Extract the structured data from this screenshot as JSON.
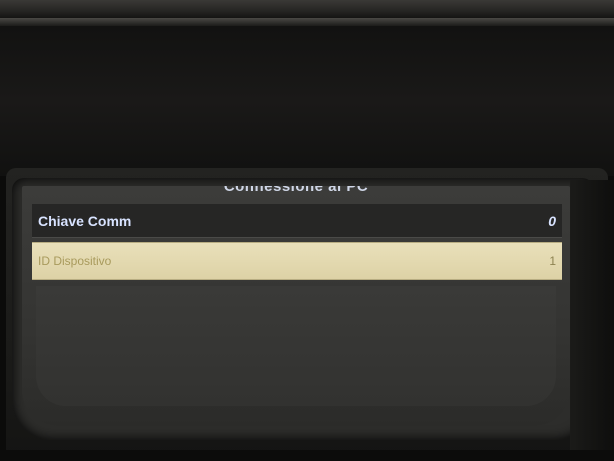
{
  "screen": {
    "title": "Connessione al PC",
    "menu": [
      {
        "label": "Chiave Comm",
        "value": "0",
        "selected": false
      },
      {
        "label": "ID Dispositivo",
        "value": "1",
        "selected": true
      }
    ]
  },
  "colors": {
    "device_body": "#121211",
    "screen_background": "#363634",
    "row_normal_text": "#d8e3ff",
    "row_selected_background": "#e5dbb3",
    "row_selected_text": "#a89a5c"
  }
}
